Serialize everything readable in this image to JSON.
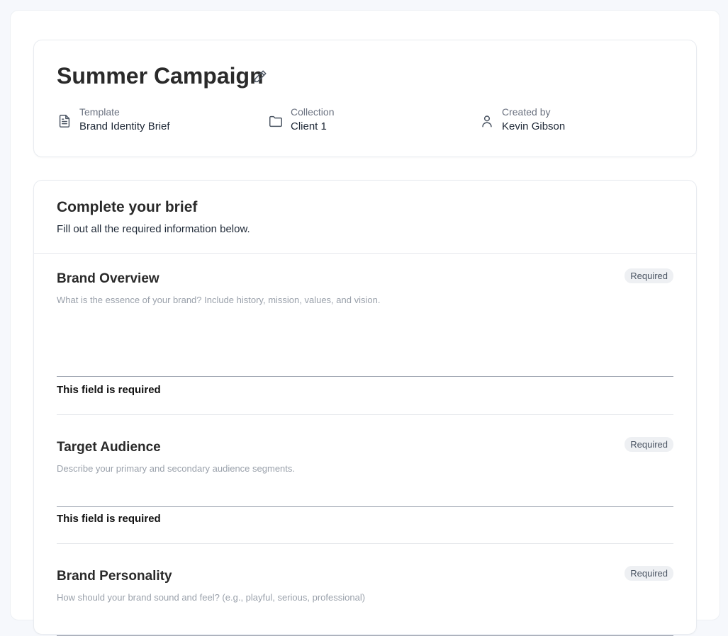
{
  "header": {
    "title": "Summer Campaign",
    "meta": {
      "template": {
        "label": "Template",
        "value": "Brand Identity Brief",
        "icon": "document-icon"
      },
      "collection": {
        "label": "Collection",
        "value": "Client 1",
        "icon": "folder-icon"
      },
      "created_by": {
        "label": "Created by",
        "value": "Kevin Gibson",
        "icon": "user-icon"
      }
    }
  },
  "brief": {
    "title": "Complete your brief",
    "subtitle": "Fill out all the required information below.",
    "sections": [
      {
        "title": "Brand Overview",
        "badge": "Required",
        "description": "What is the essence of your brand? Include history, mission, values, and vision.",
        "value": "",
        "error": "This field is required"
      },
      {
        "title": "Target Audience",
        "badge": "Required",
        "description": "Describe your primary and secondary audience segments.",
        "value": "",
        "error": "This field is required"
      },
      {
        "title": "Brand Personality",
        "badge": "Required",
        "description": "How should your brand sound and feel? (e.g., playful, serious, professional)",
        "value": ""
      }
    ]
  }
}
